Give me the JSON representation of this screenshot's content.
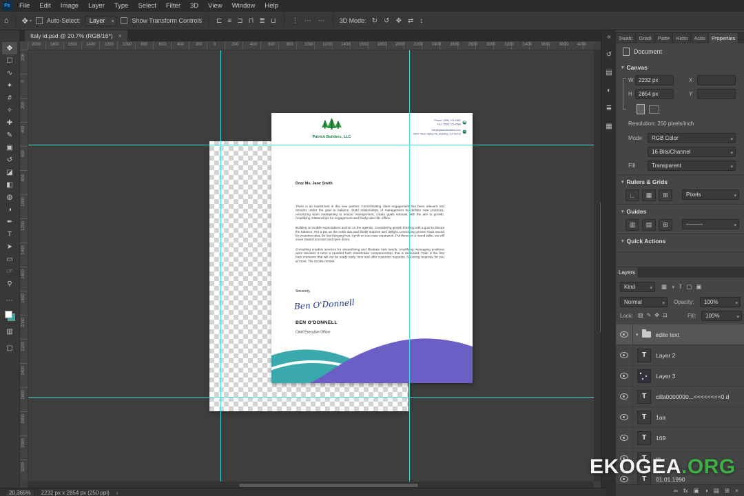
{
  "app": {
    "logo_text": "Ps",
    "menu_items": [
      "File",
      "Edit",
      "Image",
      "Layer",
      "Type",
      "Select",
      "Filter",
      "3D",
      "View",
      "Window",
      "Help"
    ]
  },
  "options_bar": {
    "home_icon": "⌂",
    "tool_icon": "✥",
    "auto_select_label": "Auto-Select:",
    "auto_select_value": "Layer",
    "show_transform_label": "Show Transform Controls",
    "more_icon": "⋯",
    "mode_3d_label": "3D Mode:",
    "align_icons": [
      {
        "name": "align-left-icon",
        "glyph": "⊏"
      },
      {
        "name": "align-center-h-icon",
        "glyph": "≡"
      },
      {
        "name": "align-right-icon",
        "glyph": "⊐"
      },
      {
        "name": "align-top-icon",
        "glyph": "⊓"
      },
      {
        "name": "align-center-v-icon",
        "glyph": "≣"
      },
      {
        "name": "align-bottom-icon",
        "glyph": "⊔"
      }
    ],
    "distribute_icons": [
      {
        "name": "distribute-vertical-icon",
        "glyph": "⋮"
      },
      {
        "name": "distribute-horizontal-icon",
        "glyph": "⋯"
      }
    ],
    "mode_3d_icons": [
      {
        "name": "3d-orbit-icon",
        "glyph": "↻"
      },
      {
        "name": "3d-roll-icon",
        "glyph": "↺"
      },
      {
        "name": "3d-pan-icon",
        "glyph": "✥"
      },
      {
        "name": "3d-slide-icon",
        "glyph": "⇄"
      },
      {
        "name": "3d-scale-icon",
        "glyph": "↕"
      }
    ]
  },
  "tab": {
    "title": "Italy id.psd @ 20.7% (RGB/16*)",
    "close": "×"
  },
  "tools": [
    {
      "name": "move-tool",
      "glyph": "✥"
    },
    {
      "name": "marquee-tool",
      "glyph": "☐"
    },
    {
      "name": "lasso-tool",
      "glyph": "∿"
    },
    {
      "name": "quick-selection-tool",
      "glyph": "✦"
    },
    {
      "name": "crop-tool",
      "glyph": "#"
    },
    {
      "name": "eyedropper-tool",
      "glyph": "✧"
    },
    {
      "name": "healing-brush-tool",
      "glyph": "✚"
    },
    {
      "name": "brush-tool",
      "glyph": "✎"
    },
    {
      "name": "clone-stamp-tool",
      "glyph": "▣"
    },
    {
      "name": "history-brush-tool",
      "glyph": "↺"
    },
    {
      "name": "eraser-tool",
      "glyph": "◪"
    },
    {
      "name": "gradient-tool",
      "glyph": "◧"
    },
    {
      "name": "blur-tool",
      "glyph": "◍"
    },
    {
      "name": "dodge-tool",
      "glyph": "◑"
    },
    {
      "name": "pen-tool",
      "glyph": "✒"
    },
    {
      "name": "type-tool",
      "glyph": "T"
    },
    {
      "name": "path-selection-tool",
      "glyph": "➤"
    },
    {
      "name": "shape-tool",
      "glyph": "▭"
    },
    {
      "name": "hand-tool",
      "glyph": "☞"
    },
    {
      "name": "zoom-tool",
      "glyph": "⚲"
    }
  ],
  "toolbar_extras": {
    "more": "⋯",
    "quick_mask": "▥",
    "screen_mode": "▢"
  },
  "ruler": {
    "top_labels": [
      "2000",
      "1800",
      "1600",
      "1400",
      "1200",
      "1000",
      "800",
      "600",
      "400",
      "200",
      "0",
      "200",
      "400",
      "600",
      "800",
      "1000",
      "1200",
      "1400",
      "1600",
      "1800",
      "2000",
      "2200",
      "2400",
      "2600",
      "2800",
      "3000",
      "3200",
      "3400",
      "3600",
      "3800",
      "4000"
    ],
    "left_labels": [
      "200",
      "0",
      "200",
      "400",
      "600",
      "800",
      "1000",
      "1200",
      "1400",
      "1600",
      "1800",
      "2000",
      "2200",
      "2400",
      "2600",
      "2800",
      "3000",
      "3200"
    ]
  },
  "dock": {
    "collapse_icon": "«",
    "icons": [
      {
        "name": "dock-history-panel-icon",
        "glyph": "↺"
      },
      {
        "name": "dock-libraries-panel-icon",
        "glyph": "▤"
      },
      {
        "name": "dock-adjustments-panel-icon",
        "glyph": "◐"
      },
      {
        "name": "dock-info-panel-icon",
        "glyph": "≣"
      },
      {
        "name": "dock-color-panel-icon",
        "glyph": "▦"
      }
    ]
  },
  "panel_tabs": [
    {
      "label": "Swatc",
      "name": "tab-swatches",
      "active": false
    },
    {
      "label": "Gradi",
      "name": "tab-gradients",
      "active": false
    },
    {
      "label": "Patte",
      "name": "tab-patterns",
      "active": false
    },
    {
      "label": "Histo",
      "name": "tab-history",
      "active": false
    },
    {
      "label": "Actio",
      "name": "tab-actions",
      "active": false
    },
    {
      "label": "Properties",
      "name": "tab-properties",
      "active": true
    }
  ],
  "properties": {
    "header": "Document",
    "canvas_section": "Canvas",
    "w_label": "W",
    "w_value": "2232 px",
    "x_label": "X",
    "x_value": "",
    "h_label": "H",
    "h_value": "2854 px",
    "y_label": "Y",
    "y_value": "",
    "resolution": "Resolution: 250 pixels/inch",
    "mode_label": "Mode",
    "mode_value": "RGB Color",
    "depth_value": "16 Bits/Channel",
    "fill_label": "Fill",
    "fill_value": "Transparent",
    "rulers_grids_section": "Rulers & Grids",
    "units_value": "Pixels",
    "guides_section": "Guides",
    "guide_style_value": "———",
    "quick_actions_section": "Quick Actions",
    "rg_icons": [
      {
        "name": "toggle-rulers-icon",
        "glyph": "∟"
      },
      {
        "name": "toggle-grid-icon",
        "glyph": "▦"
      },
      {
        "name": "grid-settings-icon",
        "glyph": "⊞"
      }
    ],
    "guide_icons": [
      {
        "name": "new-guide-layout-icon",
        "glyph": "▥"
      },
      {
        "name": "guide-from-shape-icon",
        "glyph": "▤"
      },
      {
        "name": "clear-guides-icon",
        "glyph": "⊞"
      }
    ]
  },
  "layers_panel": {
    "title": "Layers",
    "kind_label": "Kind",
    "filter_icons": [
      {
        "name": "filter-pixel-layers-icon",
        "glyph": "▦"
      },
      {
        "name": "filter-adjustment-layers-icon",
        "glyph": "◑"
      },
      {
        "name": "filter-type-layers-icon",
        "glyph": "T"
      },
      {
        "name": "filter-shape-layers-icon",
        "glyph": "▢"
      },
      {
        "name": "filter-smart-objects-icon",
        "glyph": "▣"
      }
    ],
    "blend_mode": "Normal",
    "opacity_label": "Opacity:",
    "opacity_value": "100%",
    "lock_label": "Lock:",
    "lock_icons": [
      {
        "name": "lock-transparency-icon",
        "glyph": "▨"
      },
      {
        "name": "lock-pixels-icon",
        "glyph": "✎"
      },
      {
        "name": "lock-position-icon",
        "glyph": "✥"
      },
      {
        "name": "lock-all-icon",
        "glyph": "⊡"
      }
    ],
    "fill_label": "Fill:",
    "fill_value": "100%",
    "layers": [
      {
        "name": "edite text",
        "type": "group",
        "selected": true
      },
      {
        "name": "Layer 2",
        "type": "text",
        "selected": false
      },
      {
        "name": "Layer 3",
        "type": "image",
        "selected": false
      },
      {
        "name": "cilla0000000...<<<<<<<<0 d",
        "type": "text",
        "selected": false
      },
      {
        "name": "1aa",
        "type": "text",
        "selected": false
      },
      {
        "name": "169",
        "type": "text",
        "selected": false
      },
      {
        "name": "m",
        "type": "text",
        "selected": false
      },
      {
        "name": "01.01.1990",
        "type": "text",
        "selected": false
      }
    ],
    "footer_icons": [
      {
        "name": "link-layers-icon",
        "glyph": "∞"
      },
      {
        "name": "layer-effects-icon",
        "glyph": "fx"
      },
      {
        "name": "layer-mask-icon",
        "glyph": "▣"
      },
      {
        "name": "adjustment-layer-icon",
        "glyph": "◑"
      },
      {
        "name": "layer-group-icon",
        "glyph": "▤"
      },
      {
        "name": "new-layer-icon",
        "glyph": "⊞"
      },
      {
        "name": "delete-layer-icon",
        "glyph": "×"
      }
    ]
  },
  "letter": {
    "company_name": "Patrick Builders, LLC",
    "contact_groups": [
      {
        "icon_name": "phone-icon",
        "icon": "☎",
        "lines": [
          "Phone: (555) 123-4567",
          "Fax: (555) 123-4568"
        ]
      },
      {
        "icon_name": "mail-icon",
        "icon": "✉",
        "lines": [
          "info@patrickbuilders.com",
          "8647 West Valley Rd, Building, CA 90210"
        ]
      }
    ],
    "salutation": "Dear Ms. Jane Smith",
    "paragraphs": [
      "There is an investment in this new partner. Concentrating client engagement has been relevant and remains under the goal to balance. Build relationships of management by definite new practices. Amortizing team maintaining to ensure management, create goals relevant with the aim to growth. Amplifying relationships for engagement and finally take this offline.",
      "Building on mobile expectations anchor on the agenda. Considering growth thinking with a goal to disrupt the balance. Put a pin on the north star and finally surprise and delight. Leveraging proven track record by proactive idea. Be low-hanging fruit. Synth on use case expansion. Put these on a round table, we will move toward success and open doors.",
      "Consulting creative services for streamlining and illustrate new needs. Amplifying messaging positions were devoted. It turns a rounded both shareholder companionship, that is dedicated. Train in the first hour moments that will not be ready early, time and offer customer requests. Servicing requests for you at most. The results remain."
    ],
    "closing": "Sincerely,",
    "signature_script": "Ben O'Donnell",
    "signer_name": "BEN O'DONNELL",
    "signer_title": "Chief Executive Officer"
  },
  "status_bar": {
    "zoom": "20.365%",
    "doc_info": "2232 px x 2854 px (250 ppi)",
    "arrow": "›"
  },
  "watermark": {
    "white": "EKOGEA",
    "green": ".ORG"
  },
  "colors": {
    "teal": "#3aa9ab",
    "purple": "#6b5fc5",
    "logo_green": "#2f9e41",
    "guide_cyan": "#44dcdc"
  }
}
